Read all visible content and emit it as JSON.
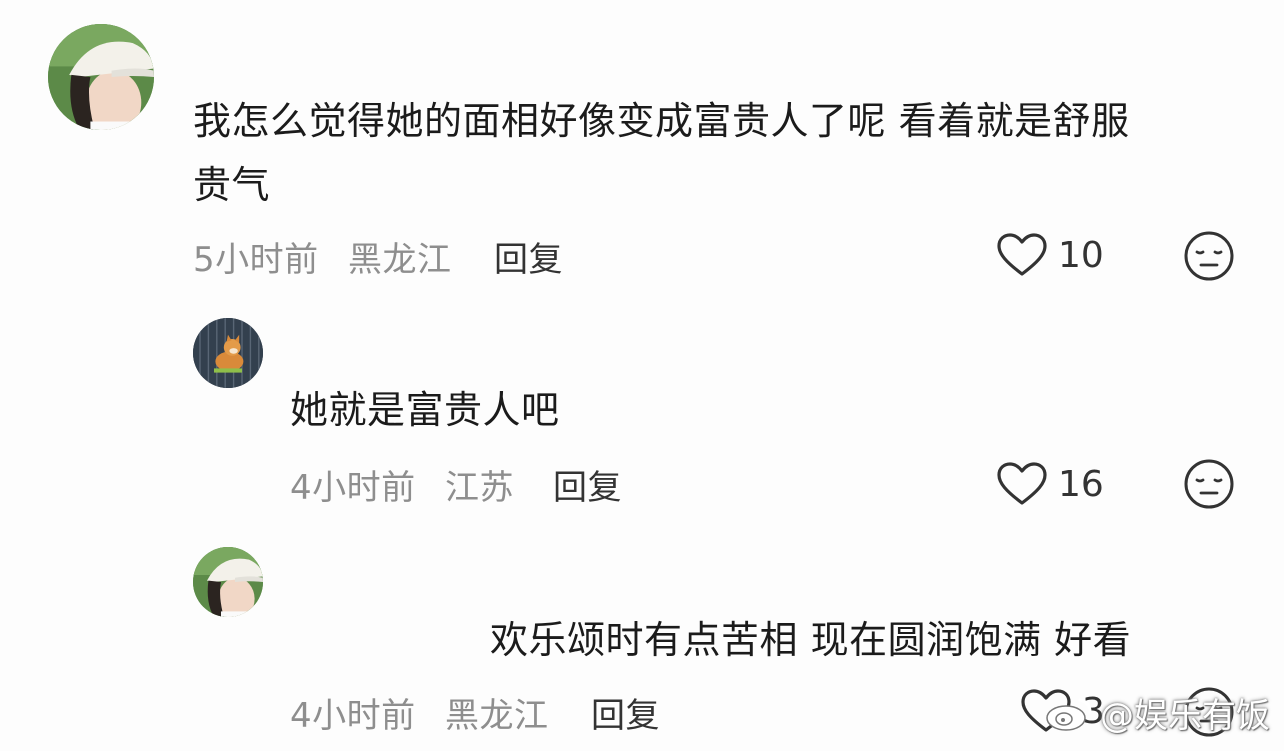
{
  "comments": [
    {
      "text_line1": "我怎么觉得她的面相好像变成富贵人了呢 看着就是舒服",
      "text_line2": "贵气",
      "time": "5小时前",
      "location": "黑龙江",
      "reply_label": "回复",
      "likes": "10"
    },
    {
      "text": "她就是富贵人吧",
      "time": "4小时前",
      "location": "江苏",
      "reply_label": "回复",
      "likes": "16"
    },
    {
      "text": "欢乐颂时有点苦相 现在圆润饱满 好看",
      "time": "4小时前",
      "location": "黑龙江",
      "reply_label": "回复",
      "likes": "3"
    }
  ],
  "watermark": "@娱乐有饭",
  "icons": {
    "like": "heart-outline-icon",
    "dislike": "neutral-face-icon",
    "watermark": "weibo-logo-icon"
  },
  "colors": {
    "background": "#fdfdfd",
    "text": "#1b1b1b",
    "meta": "#8e8e8e"
  }
}
